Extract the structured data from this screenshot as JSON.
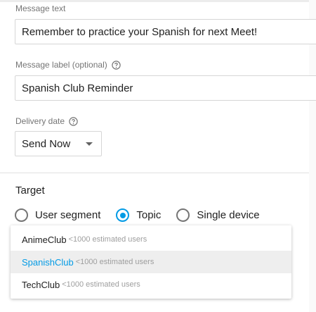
{
  "colors": {
    "accent": "#039be5",
    "label": "#757575",
    "meta": "#9e9e9e",
    "highlight_bg": "#eeeeee"
  },
  "message_text": {
    "label": "Message text",
    "value": "Remember to practice your Spanish for next Meet!"
  },
  "message_label": {
    "label": "Message label (optional)",
    "help_icon": "help-circle-icon",
    "value": "Spanish Club Reminder"
  },
  "delivery_date": {
    "label": "Delivery date",
    "help_icon": "help-circle-icon",
    "selected": "Send Now",
    "caret_icon": "caret-down-icon"
  },
  "target": {
    "title": "Target",
    "options": [
      {
        "label": "User segment",
        "checked": false
      },
      {
        "label": "Topic",
        "checked": true
      },
      {
        "label": "Single device",
        "checked": false
      }
    ]
  },
  "topic_dropdown": {
    "items": [
      {
        "name": "AnimeClub",
        "meta": "<1000 estimated users",
        "highlighted": false
      },
      {
        "name": "SpanishClub",
        "meta": "<1000 estimated users",
        "highlighted": true
      },
      {
        "name": "TechClub",
        "meta": "<1000 estimated users",
        "highlighted": false
      }
    ]
  }
}
